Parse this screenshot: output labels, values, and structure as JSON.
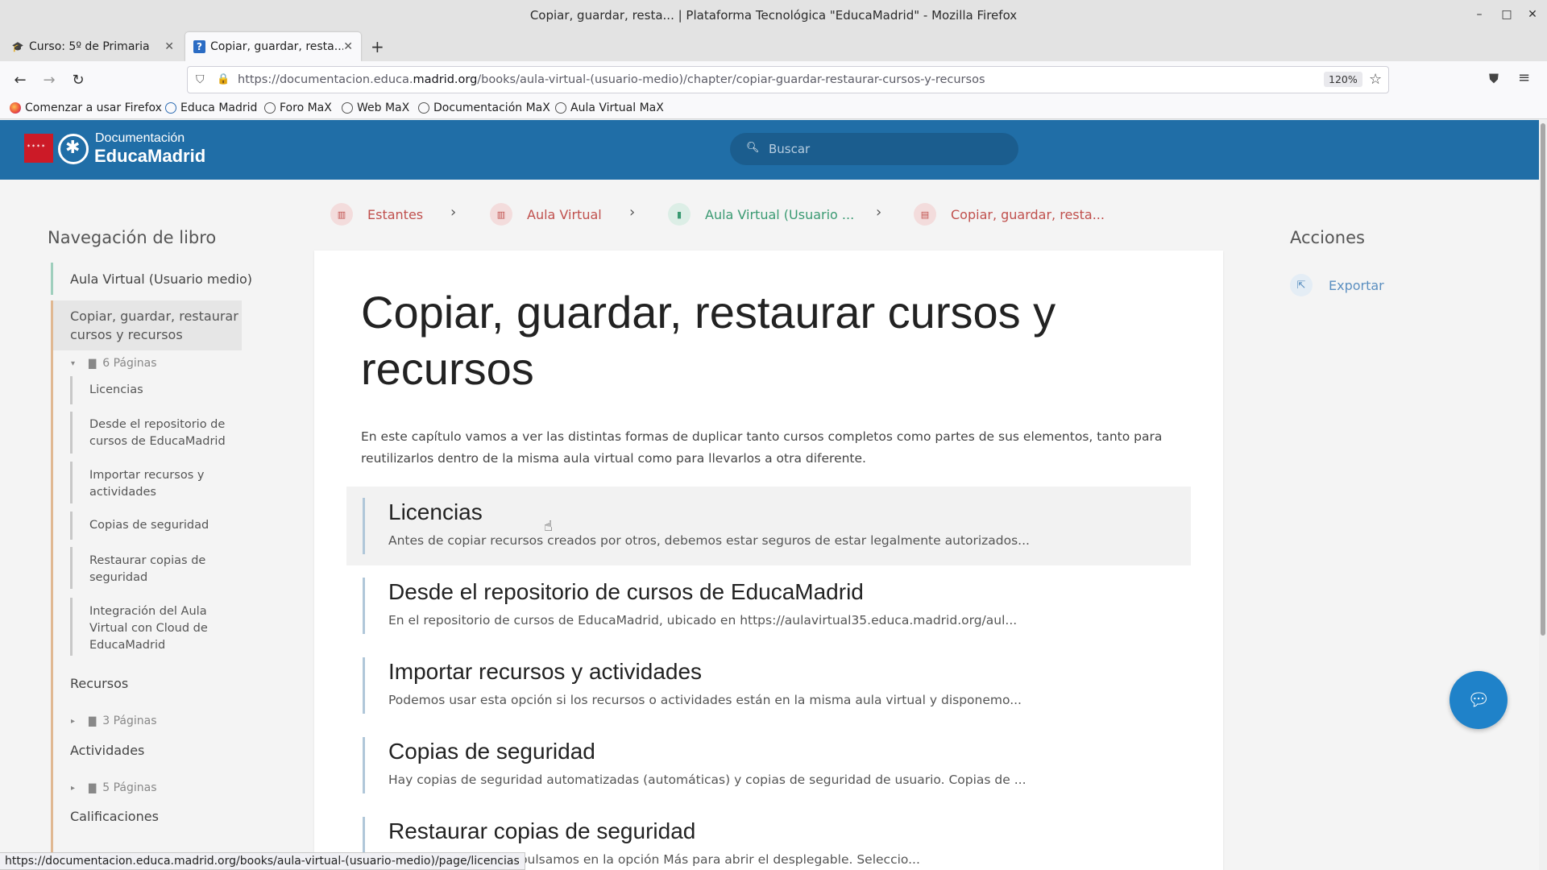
{
  "window": {
    "title": "Copiar, guardar, resta... | Plataforma Tecnológica \"EducaMadrid\" - Mozilla Firefox",
    "controls": {
      "minimize": "–",
      "maximize": "□",
      "close": "✕"
    }
  },
  "tabs": [
    {
      "label": "Curso: 5º de Primaria",
      "icon": "graduation-cap-icon",
      "active": false
    },
    {
      "label": "Copiar, guardar, resta... | ",
      "icon": "question-icon",
      "active": true
    }
  ],
  "toolbar": {
    "url_prefix": "https://documentacion.educa.",
    "url_domain": "madrid.org",
    "url_path": "/books/aula-virtual-(usuario-medio)/chapter/copiar-guardar-restaurar-cursos-y-recursos",
    "zoom": "120%"
  },
  "bookmarks": [
    {
      "label": "Comenzar a usar Firefox",
      "icon": "firefox-icon"
    },
    {
      "label": "Educa Madrid",
      "icon": "educamadrid-icon"
    },
    {
      "label": "Foro MaX",
      "icon": "globe-icon"
    },
    {
      "label": "Web MaX",
      "icon": "globe-icon"
    },
    {
      "label": "Documentación MaX",
      "icon": "globe-icon"
    },
    {
      "label": "Aula Virtual MaX",
      "icon": "globe-icon"
    }
  ],
  "header": {
    "logo_line1": "Documentación",
    "logo_line2": "EducaMadrid",
    "search_placeholder": "Buscar"
  },
  "breadcrumbs": [
    {
      "label": "Estantes",
      "color": "#c0504d"
    },
    {
      "label": "Aula Virtual",
      "color": "#c0504d"
    },
    {
      "label": "Aula Virtual (Usuario ...",
      "color": "#3a9a72"
    },
    {
      "label": "Copiar, guardar, resta...",
      "color": "#c0504d"
    }
  ],
  "sidebar": {
    "title": "Navegación de libro",
    "book": "Aula Virtual (Usuario medio)",
    "active_chapter": "Copiar, guardar, restaurar cursos y recursos",
    "active_pages": "6 Páginas",
    "active_subpages": [
      "Licencias",
      "Desde el repositorio de cursos de EducaMadrid",
      "Importar recursos y actividades",
      "Copias de seguridad",
      "Restaurar copias de seguridad",
      "Integración del Aula Virtual con Cloud de EducaMadrid"
    ],
    "chapters": [
      {
        "label": "Recursos",
        "pages": "3 Páginas"
      },
      {
        "label": "Actividades",
        "pages": "5 Páginas"
      },
      {
        "label": "Calificaciones",
        "pages": ""
      }
    ]
  },
  "main": {
    "title": "Copiar, guardar, restaurar cursos y recursos",
    "intro": "En este capítulo vamos a ver las distintas formas de duplicar tanto cursos completos como partes de sus elementos, tanto para reutilizarlos dentro de la misma aula virtual como para llevarlos a otra diferente.",
    "entries": [
      {
        "title": "Licencias",
        "text": "Antes de copiar recursos creados por otros, debemos estar seguros de estar legalmente autorizados..."
      },
      {
        "title": "Desde el repositorio de cursos de EducaMadrid",
        "text": "En el repositorio de cursos de EducaMadrid, ubicado en https://aulavirtual35.educa.madrid.org/aul..."
      },
      {
        "title": "Importar recursos y actividades",
        "text": "Podemos usar esta opción si los recursos o actividades están en la misma aula virtual y disponemo..."
      },
      {
        "title": "Copias de seguridad",
        "text": "Hay copias de seguridad automatizadas (automáticas) y copias de seguridad de usuario. Copias de ..."
      },
      {
        "title": "Restaurar copias de seguridad",
        "text": "...pias de seguridad, pulsamos en la opción Más para abrir el desplegable. Seleccio..."
      }
    ]
  },
  "actions": {
    "title": "Acciones",
    "export_label": "Exportar"
  },
  "status_url": "https://documentacion.educa.madrid.org/books/aula-virtual-(usuario-medio)/page/licencias",
  "colors": {
    "header_bg": "#206ea7",
    "chapter_accent": "#e0b892",
    "book_accent": "#9fcfbd",
    "chat_button": "#1f82c9"
  }
}
